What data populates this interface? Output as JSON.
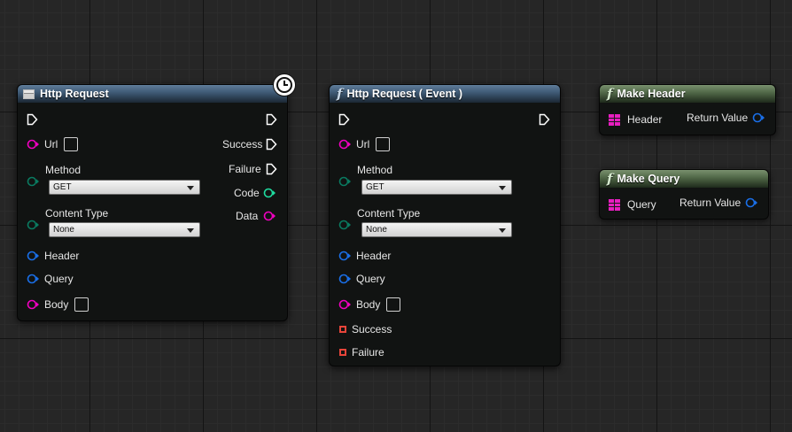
{
  "nodes": {
    "http_request_macro": {
      "title": "Http Request",
      "url_label": "Url",
      "method_label": "Method",
      "method_value": "GET",
      "content_type_label": "Content Type",
      "content_type_value": "None",
      "header_label": "Header",
      "query_label": "Query",
      "body_label": "Body",
      "success_label": "Success",
      "failure_label": "Failure",
      "code_label": "Code",
      "data_label": "Data"
    },
    "http_request_event": {
      "title": "Http Request ( Event )",
      "url_label": "Url",
      "method_label": "Method",
      "method_value": "GET",
      "content_type_label": "Content Type",
      "content_type_value": "None",
      "header_label": "Header",
      "query_label": "Query",
      "body_label": "Body",
      "success_label": "Success",
      "failure_label": "Failure"
    },
    "make_header": {
      "title": "Make Header",
      "input_label": "Header",
      "output_label": "Return Value"
    },
    "make_query": {
      "title": "Make Query",
      "input_label": "Query",
      "output_label": "Return Value"
    }
  },
  "pin_colors": {
    "exec": "#ffffff",
    "string": "#f000c0",
    "enum": "#0a7a60",
    "struct": "#1a6fe8",
    "int": "#1fdca0",
    "delegate": "#e8453a",
    "struct_grid": "#e81ec0"
  },
  "icons": {
    "macro": "macro-icon",
    "function": "function-icon",
    "latent": "clock-icon"
  }
}
